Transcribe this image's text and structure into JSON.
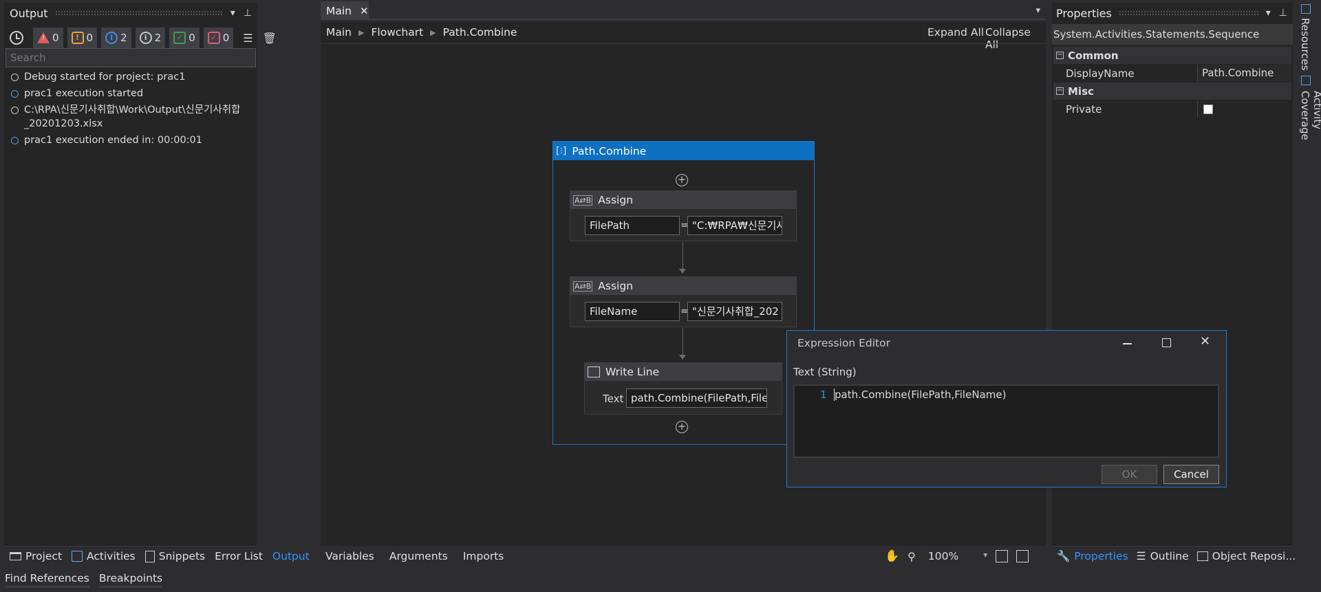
{
  "output_panel": {
    "title": "Output",
    "filters": [
      {
        "icon": "clock-icon",
        "count": ""
      },
      {
        "icon": "error-icon",
        "count": "0"
      },
      {
        "icon": "warning-icon",
        "count": "0"
      },
      {
        "icon": "info-icon",
        "count": "2"
      },
      {
        "icon": "trace-icon",
        "count": "2"
      },
      {
        "icon": "success-icon",
        "count": "0"
      },
      {
        "icon": "fail-icon",
        "count": "0"
      }
    ],
    "search_placeholder": "Search",
    "log": [
      "Debug started for project: prac1",
      "prac1 execution started",
      "C:\\RPA\\신문기사취합\\Work\\Output\\신문기사취합_20201203.xlsx",
      "prac1 execution ended in: 00:00:01"
    ],
    "log_line3a": "C:\\RPA\\신문기사취합\\Work\\Output\\신문기사취합",
    "log_line3b": "_20201203.xlsx",
    "tabs": [
      "Project",
      "Activities",
      "Snippets",
      "Error List",
      "Output"
    ]
  },
  "status_tabs": [
    "Find References",
    "Breakpoints"
  ],
  "designer": {
    "tab": "Main",
    "breadcrumb": [
      "Main",
      "Flowchart",
      "Path.Combine"
    ],
    "expand_all": "Expand All",
    "collapse_all": "Collapse All",
    "sequence_title": "Path.Combine",
    "assign1": {
      "title": "Assign",
      "to": "FilePath",
      "value": "\"C:₩RPA₩신문기사"
    },
    "assign2": {
      "title": "Assign",
      "to": "FileName",
      "value": "\"신문기사취합_202"
    },
    "writeline": {
      "title": "Write Line",
      "label": "Text",
      "value": "path.Combine(FilePath,FileN"
    },
    "equals": "=",
    "bottom_tabs": [
      "Variables",
      "Arguments",
      "Imports"
    ],
    "zoom": "100%"
  },
  "properties": {
    "title": "Properties",
    "type": "System.Activities.Statements.Sequence",
    "cat_common": "Common",
    "cat_misc": "Misc",
    "display_name_label": "DisplayName",
    "display_name_value": "Path.Combine",
    "private_label": "Private",
    "tabs": [
      "Properties",
      "Outline",
      "Object Reposi..."
    ]
  },
  "side_tabs": [
    "Resources",
    "Activity Coverage"
  ],
  "expression_editor": {
    "title": "Expression Editor",
    "type_label": "Text (String)",
    "line_number": "1",
    "code": "path.Combine(FilePath,FileName)",
    "ok": "OK",
    "cancel": "Cancel"
  },
  "colors": {
    "accent": "#0e70c0",
    "link": "#3794ff"
  }
}
